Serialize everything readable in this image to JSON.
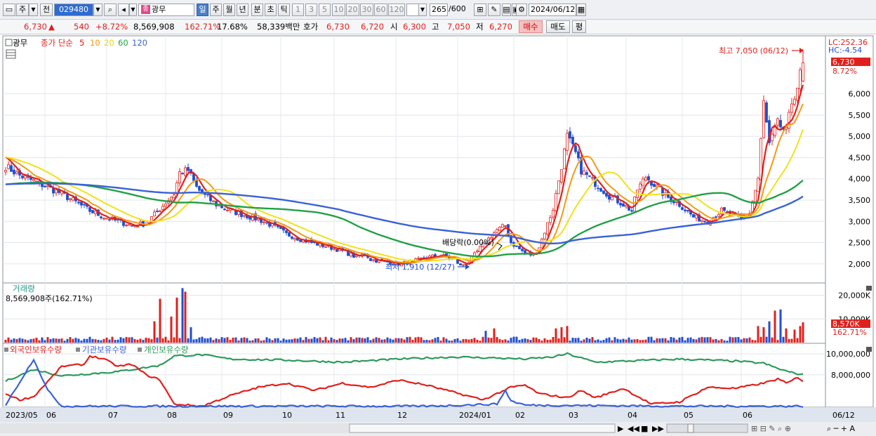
{
  "toolbar": {
    "market_label": "주",
    "prev_label": "전",
    "code": "029480",
    "name_badge": "종",
    "name": "광무",
    "periods": [
      "일",
      "주",
      "월",
      "년",
      "분",
      "초",
      "틱"
    ],
    "active_period": "일",
    "ticks": [
      "1",
      "3",
      "5",
      "10",
      "20",
      "30",
      "60",
      "120"
    ],
    "count": "265",
    "total": "/600",
    "date": "2024/06/12"
  },
  "quote": {
    "price": "6,730",
    "change": "540",
    "change_pct": "+8.72%",
    "volume": "8,569,908",
    "volume_ratio": "162.71%",
    "turnover": "17.68%",
    "amount": "58,339백만",
    "hoga_label": "호가",
    "ask": "6,730",
    "bid": "6,720",
    "open_label": "시",
    "open": "6,300",
    "high_label": "고",
    "high": "7,050",
    "low_label": "저",
    "low": "6,270",
    "buy_label": "매수",
    "sell_label": "매도",
    "avg_label": "평"
  },
  "legend": {
    "name": "광무",
    "price_label": "종가 단순",
    "ma_labels": [
      "5",
      "10",
      "20",
      "60",
      "120"
    ],
    "volume_label": "거래량",
    "volume_value": "8,569,908주(162.71%)",
    "holdings": [
      "외국인보유수량",
      "기관보유수량",
      "개인보유수량"
    ],
    "lc": "LC:252.36",
    "hc": "HC:-4.54",
    "last_price": "6,730",
    "last_pct": "8.72%",
    "vol_last": "8,570K",
    "vol_last_pct": "162.71%",
    "high_note": "최고 7,050 (06/12)",
    "low_note": "최저 1,910 (12/27)",
    "div_note": "배당락(0.00%)",
    "right_date": "06/12"
  },
  "colors": {
    "candle_up": "#e0201c",
    "candle_down": "#1f4fd0",
    "ma5": "#e0201c",
    "ma10": "#f29a14",
    "ma20": "#f0e21a",
    "ma60": "#24a048",
    "ma120": "#3a62d6",
    "foreign": "#e0201c",
    "institution": "#3a62d6",
    "individual": "#2e9a5c"
  },
  "chart_data": {
    "type": "candlestick",
    "price_axis": {
      "ticks": [
        2000,
        2500,
        3000,
        3500,
        4000,
        4500,
        5000,
        5500,
        6000
      ],
      "ylim": [
        1600,
        7300
      ]
    },
    "volume_axis": {
      "ticks": [
        "20,000K",
        "10,000K"
      ],
      "tick_values": [
        20000,
        10000
      ],
      "ylim": [
        0,
        24000
      ]
    },
    "holding_axis": {
      "ticks": [
        "10,000,000",
        "8,000,000"
      ],
      "tick_values": [
        10000000,
        8000000
      ]
    },
    "x_labels": [
      "2023/05",
      "06",
      "07",
      "08",
      "09",
      "10",
      "11",
      "12",
      "2024/01",
      "02",
      "03",
      "04",
      "05",
      "06"
    ],
    "close_path": [
      [
        0,
        4300
      ],
      [
        5,
        4080
      ],
      [
        10,
        3950
      ],
      [
        15,
        3800
      ],
      [
        20,
        3650
      ],
      [
        25,
        3450
      ],
      [
        30,
        3250
      ],
      [
        35,
        3100
      ],
      [
        40,
        3000
      ],
      [
        45,
        2900
      ],
      [
        50,
        2950
      ],
      [
        55,
        3300
      ],
      [
        60,
        3650
      ],
      [
        62,
        4150
      ],
      [
        65,
        4200
      ],
      [
        68,
        3800
      ],
      [
        70,
        3650
      ],
      [
        75,
        3400
      ],
      [
        80,
        3250
      ],
      [
        85,
        3150
      ],
      [
        90,
        3050
      ],
      [
        95,
        2900
      ],
      [
        100,
        2700
      ],
      [
        105,
        2580
      ],
      [
        110,
        2480
      ],
      [
        115,
        2400
      ],
      [
        120,
        2300
      ],
      [
        125,
        2150
      ],
      [
        128,
        2250
      ],
      [
        130,
        2100
      ],
      [
        135,
        2050
      ],
      [
        140,
        2000
      ],
      [
        145,
        2050
      ],
      [
        150,
        2150
      ],
      [
        155,
        2200
      ],
      [
        160,
        2100
      ],
      [
        162,
        1950
      ],
      [
        165,
        2050
      ],
      [
        170,
        2450
      ],
      [
        175,
        2800
      ],
      [
        178,
        2900
      ],
      [
        180,
        2500
      ],
      [
        185,
        2250
      ],
      [
        188,
        2200
      ],
      [
        190,
        2400
      ],
      [
        195,
        3300
      ],
      [
        198,
        4300
      ],
      [
        200,
        5000
      ],
      [
        203,
        4600
      ],
      [
        205,
        4200
      ],
      [
        210,
        3900
      ],
      [
        215,
        3600
      ],
      [
        220,
        3400
      ],
      [
        223,
        3250
      ],
      [
        225,
        3750
      ],
      [
        228,
        4050
      ],
      [
        232,
        3800
      ],
      [
        235,
        3600
      ],
      [
        240,
        3400
      ],
      [
        245,
        3100
      ],
      [
        250,
        3000
      ],
      [
        255,
        3250
      ],
      [
        258,
        3150
      ],
      [
        262,
        3050
      ],
      [
        265,
        3200
      ],
      [
        268,
        4000
      ],
      [
        270,
        5800
      ],
      [
        272,
        4800
      ],
      [
        275,
        5300
      ],
      [
        278,
        5100
      ],
      [
        280,
        5800
      ],
      [
        282,
        6180
      ],
      [
        284,
        6730
      ]
    ],
    "ohlc_last": {
      "open": 6300,
      "high": 7050,
      "low": 6270,
      "close": 6730
    },
    "volume_spikes": [
      {
        "x": 53,
        "value": 9000
      },
      {
        "x": 55,
        "value": 18500
      },
      {
        "x": 59,
        "value": 11000
      },
      {
        "x": 61,
        "value": 19000
      },
      {
        "x": 63,
        "value": 23000
      },
      {
        "x": 64,
        "value": 21500
      },
      {
        "x": 66,
        "value": 6500
      },
      {
        "x": 171,
        "value": 5000
      },
      {
        "x": 174,
        "value": 6000
      },
      {
        "x": 196,
        "value": 6000
      },
      {
        "x": 198,
        "value": 6500
      },
      {
        "x": 200,
        "value": 7000
      },
      {
        "x": 268,
        "value": 7000
      },
      {
        "x": 270,
        "value": 6500
      },
      {
        "x": 272,
        "value": 9000
      },
      {
        "x": 274,
        "value": 13500
      },
      {
        "x": 276,
        "value": 14000
      },
      {
        "x": 278,
        "value": 6000
      },
      {
        "x": 281,
        "value": 5500
      },
      {
        "x": 283,
        "value": 7000
      },
      {
        "x": 284,
        "value": 8570
      }
    ],
    "series": [
      {
        "name": "5",
        "kind": "ma",
        "period": 5
      },
      {
        "name": "10",
        "kind": "ma",
        "period": 10
      },
      {
        "name": "20",
        "kind": "ma",
        "period": 20
      },
      {
        "name": "60",
        "kind": "ma",
        "period": 60
      },
      {
        "name": "120",
        "kind": "ma",
        "period": 120
      }
    ],
    "holdings": {
      "foreign_path": [
        [
          0,
          6.2
        ],
        [
          5,
          5.6
        ],
        [
          10,
          5.9
        ],
        [
          20,
          8.8
        ],
        [
          28,
          9.0
        ],
        [
          30,
          9.8
        ],
        [
          35,
          9.5
        ],
        [
          40,
          8.8
        ],
        [
          45,
          9.0
        ],
        [
          50,
          8.0
        ],
        [
          55,
          7.5
        ],
        [
          60,
          5.2
        ],
        [
          70,
          5.0
        ],
        [
          80,
          6.0
        ],
        [
          90,
          6.8
        ],
        [
          100,
          7.2
        ],
        [
          110,
          6.5
        ],
        [
          120,
          7.2
        ],
        [
          130,
          6.8
        ],
        [
          140,
          7.5
        ],
        [
          150,
          7.0
        ],
        [
          160,
          6.3
        ],
        [
          170,
          5.6
        ],
        [
          180,
          6.8
        ],
        [
          185,
          7.0
        ],
        [
          190,
          6.2
        ],
        [
          200,
          5.8
        ],
        [
          205,
          6.5
        ],
        [
          210,
          5.8
        ],
        [
          220,
          6.7
        ],
        [
          230,
          5.2
        ],
        [
          240,
          5.4
        ],
        [
          250,
          6.8
        ],
        [
          260,
          6.7
        ],
        [
          270,
          7.2
        ],
        [
          275,
          7.6
        ],
        [
          278,
          7.2
        ],
        [
          280,
          7.4
        ],
        [
          282,
          7.8
        ],
        [
          284,
          7.4
        ]
      ],
      "institution_path": [
        [
          0,
          5.1
        ],
        [
          10,
          9.5
        ],
        [
          15,
          6.5
        ],
        [
          20,
          5.0
        ],
        [
          100,
          5.0
        ],
        [
          150,
          5.0
        ],
        [
          175,
          5.2
        ],
        [
          178,
          6.5
        ],
        [
          180,
          5.5
        ],
        [
          185,
          5.1
        ],
        [
          240,
          5.0
        ],
        [
          284,
          5.0
        ]
      ],
      "individual_path": [
        [
          0,
          7.4
        ],
        [
          10,
          8.5
        ],
        [
          20,
          7.9
        ],
        [
          40,
          8.3
        ],
        [
          55,
          8.9
        ],
        [
          60,
          9.8
        ],
        [
          70,
          9.9
        ],
        [
          80,
          9.5
        ],
        [
          100,
          9.4
        ],
        [
          120,
          9.2
        ],
        [
          140,
          9.5
        ],
        [
          160,
          9.7
        ],
        [
          175,
          9.6
        ],
        [
          185,
          9.5
        ],
        [
          195,
          9.7
        ],
        [
          200,
          10.0
        ],
        [
          205,
          9.6
        ],
        [
          210,
          9.2
        ],
        [
          220,
          9.3
        ],
        [
          240,
          9.5
        ],
        [
          260,
          9.3
        ],
        [
          270,
          9.1
        ],
        [
          275,
          8.6
        ],
        [
          280,
          8.2
        ],
        [
          284,
          8.0
        ]
      ]
    }
  }
}
